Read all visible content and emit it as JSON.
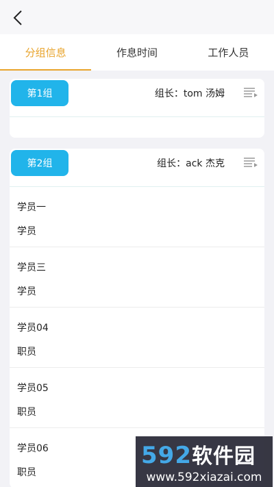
{
  "header": {
    "back_icon": "chevron-left-icon"
  },
  "tabs": [
    {
      "label": "分组信息",
      "active": true
    },
    {
      "label": "作息时间",
      "active": false
    },
    {
      "label": "工作人员",
      "active": false
    }
  ],
  "groups": [
    {
      "badge": "第1组",
      "leader": "组长：tom 汤姆",
      "members": []
    },
    {
      "badge": "第2组",
      "leader": "组长：ack 杰克",
      "members": [
        {
          "name": "学员一",
          "role": "学员"
        },
        {
          "name": "学员三",
          "role": "学员"
        },
        {
          "name": "学员04",
          "role": "职员"
        },
        {
          "name": "学员05",
          "role": "职员"
        },
        {
          "name": "学员06",
          "role": "职员"
        }
      ]
    }
  ],
  "watermark": {
    "brand_num": "592",
    "brand_cn": "软件园",
    "url": "www.592xiazai.com"
  },
  "colors": {
    "accent": "#e8a32a",
    "badge": "#21b4ea"
  }
}
